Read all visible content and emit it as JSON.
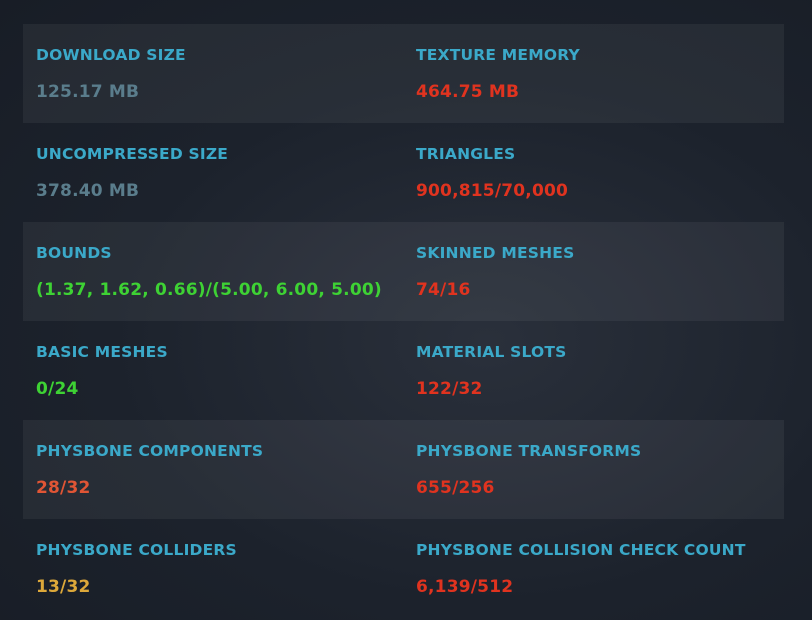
{
  "colors": {
    "label": "#3ba9c9",
    "neutral": "#5a7d8c",
    "bad": "#e0331f",
    "poor": "#e05535",
    "good": "#3ed234",
    "medium": "#dda83a"
  },
  "stats": [
    {
      "left": {
        "label": "DOWNLOAD SIZE",
        "value": "125.17 MB"
      },
      "right": {
        "label": "TEXTURE MEMORY",
        "value": "464.75 MB"
      }
    },
    {
      "left": {
        "label": "UNCOMPRESSED SIZE",
        "value": "378.40 MB"
      },
      "right": {
        "label": "TRIANGLES",
        "value": "900,815/70,000"
      }
    },
    {
      "left": {
        "label": "BOUNDS",
        "value": "(1.37, 1.62, 0.66)/(5.00, 6.00, 5.00)"
      },
      "right": {
        "label": "SKINNED MESHES",
        "value": "74/16"
      }
    },
    {
      "left": {
        "label": "BASIC MESHES",
        "value": "0/24"
      },
      "right": {
        "label": "MATERIAL SLOTS",
        "value": "122/32"
      }
    },
    {
      "left": {
        "label": "PHYSBONE COMPONENTS",
        "value": "28/32"
      },
      "right": {
        "label": "PHYSBONE TRANSFORMS",
        "value": "655/256"
      }
    },
    {
      "left": {
        "label": "PHYSBONE COLLIDERS",
        "value": "13/32"
      },
      "right": {
        "label": "PHYSBONE COLLISION CHECK COUNT",
        "value": "6,139/512"
      }
    }
  ]
}
